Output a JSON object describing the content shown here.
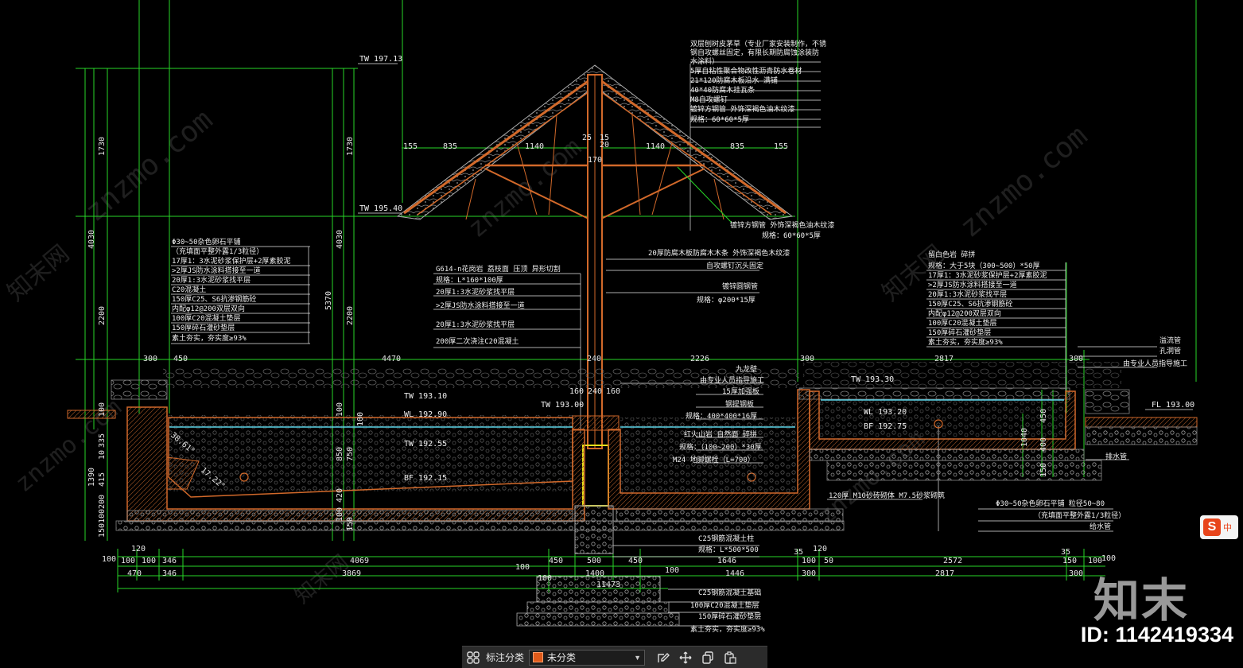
{
  "toolbar": {
    "category_label": "标注分类",
    "category_value": "未分类",
    "icons": [
      "grid-icon",
      "edit-icon",
      "move-icon",
      "copy-icon",
      "paste-icon"
    ]
  },
  "brand": {
    "logo_text": "知末",
    "id_text": "ID: 1142419334",
    "watermark": "znzmo.com",
    "watermark_cn": "知末网",
    "ime_badge": "中"
  },
  "levels": {
    "tw1": "TW 197.13",
    "tw2": "TW 195.40",
    "tw3": "TW 193.10",
    "wl1": "WL 192.90",
    "tw4": "TW 192.55",
    "bf1": "BF 192.15",
    "tw5": "TW 193.00",
    "tw6": "TW 193.30",
    "wl2": "WL 193.20",
    "bf2": "BF 192.75",
    "fl": "FL 193.00"
  },
  "dims": {
    "left_vert": [
      "1730",
      "4030",
      "2200",
      "100",
      "335",
      "10",
      "1390",
      "415",
      "200",
      "100",
      "150"
    ],
    "mid_vert": [
      "1730",
      "4030",
      "2200",
      "5370",
      "100",
      "100",
      "850",
      "750",
      "420",
      "150",
      "100"
    ],
    "roof": [
      "155",
      "835",
      "1140",
      "25",
      "15",
      "20",
      "1140",
      "835",
      "155",
      "170"
    ],
    "top_row": [
      "300",
      "450",
      "4470",
      "240",
      "2226",
      "300",
      "2817",
      "300"
    ],
    "post_row": [
      "160",
      "240",
      "160"
    ],
    "bottom1": [
      "120",
      "35",
      "120",
      "35",
      "100"
    ],
    "bottom2": [
      "100",
      "100",
      "100",
      "346",
      "4069",
      "100",
      "450",
      "500",
      "450",
      "1646",
      "100",
      "50",
      "2572",
      "150",
      "100"
    ],
    "bottom3": [
      "470",
      "346",
      "3869",
      "100",
      "1400",
      "100",
      "1446",
      "300",
      "2817",
      "300"
    ],
    "total": "11473",
    "right_vert": [
      "450",
      "1040",
      "400",
      "150"
    ],
    "angle1": "38.61°",
    "angle2": "17.22°"
  },
  "notes": {
    "roof_spec": [
      "双层刨树皮茅草（专业厂家安装制作，不锈",
      "钢自攻螺丝固定，有限长期防腐蚀涂装防",
      "水涂料）",
      "5厚自粘性聚合物改性沥青防水卷材",
      "21*120防腐木板沿水  满铺",
      "40*40防腐木挂瓦条",
      "M8自攻螺钉",
      "镀锌方钢管  外饰深褐色油木纹漆",
      "规格：60*60*5厚"
    ],
    "roof_bottom": [
      "镀锌方钢管  外饰深褐色油木纹漆",
      "规格：60*60*5厚"
    ],
    "post_spec": [
      "20厚防腐木板防腐木木条  外饰深褐色木纹漆",
      "自攻螺钉沉头固定",
      "镀锌圆钢管",
      "规格：φ200*15厚"
    ],
    "left_spec": [
      "Φ30~50杂色卵石平铺",
      "（充填面平整外露1/3粒径）",
      "17厚1：3水泥砂浆保护层+2厚素胶泥",
      ">2厚JS防水涂料搭接至一道",
      "20厚1:3水泥砂浆找平层",
      "C20混凝土",
      "150厚C25、S6抗渗钢筋砼",
      "内配φ12@200双层双向",
      "100厚C20混凝土垫层",
      "150厚碎石灌砂垫层",
      "素土夯实，夯实度≥93%"
    ],
    "mid_spec": [
      "G614-n花岗岩  荔枝面 压顶  异形切割",
      "规格：L*160*100厚",
      "20厚1:3水泥砂浆找平层",
      ">2厚JS防水涂料搭接至一道",
      "20厚1:3水泥砂浆找平层",
      "200厚二次浇注C20混凝土"
    ],
    "right_spec": [
      "留白色岩  碎拼",
      "规格：大于5块（300~500）*50厚",
      "17厚1：3水泥砂浆保护层+2厚素胶泥",
      ">2厚JS防水涂料搭接至一道",
      "20厚1:3水泥砂浆找平层",
      "150厚C25、S6抗渗钢筋砼",
      "内配φ12@200双层双向",
      "100厚C20混凝土垫层",
      "150厚碎石灌砂垫层",
      "素土夯实，夯实度≥93%"
    ],
    "right_edge": [
      "溢流管",
      "孔洞管",
      "由专业人员指导施工"
    ],
    "center_spec": [
      "九龙壁",
      "由专业人员指导施工",
      "15厚加强板",
      "钢提钢板",
      "规格：400*400*16厚",
      "红火山岩  自然面  碎拼",
      "规格：（100~200）*30厚",
      "M24 地脚螺栓（L=700）"
    ],
    "wall_note": "120厚 M10砂砖砌体  M7.5砂浆砌筑",
    "pebble_note": [
      "Φ30~50杂色卵石平铺  粒径50~80",
      "（充填面平整外露1/3粒径）",
      "给水管"
    ],
    "drain_note": "排水管",
    "footing_spec": [
      "C25钢筋混凝土柱",
      "规格：L*500*500"
    ],
    "base_spec": [
      "C25钢筋混凝土基础",
      "100厚C20混凝土垫层",
      "150厚碎石灌砂垫层",
      "素土夯实，夯实度≥93%"
    ]
  },
  "colors": {
    "background": "#000000",
    "dim_green": "#27d627",
    "hatch_orange": "#d2692a",
    "water_cyan": "#5ad2e6",
    "post_yellow": "#e8e11a",
    "text_white": "#f0f0f0"
  }
}
